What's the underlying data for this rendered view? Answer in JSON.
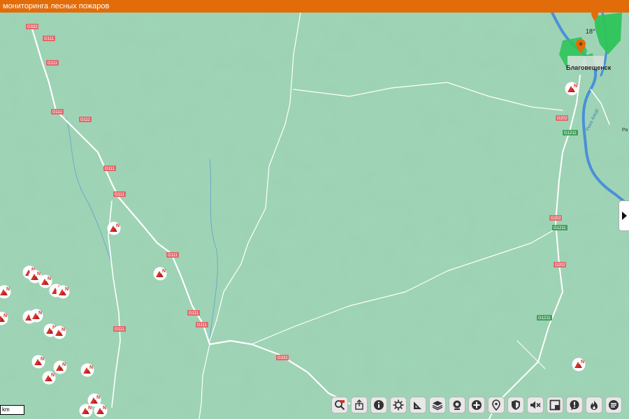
{
  "header": {
    "title": "мониторинга лесных пожаров"
  },
  "map": {
    "city": "Благовещенск",
    "river_label": "Река Амур",
    "right_edge_label": "Ра",
    "temperature_label": "18°",
    "road_labels": {
      "g332": "G332",
      "g111": "G111",
      "g202": "G202",
      "g1211": "G1211"
    }
  },
  "scale": {
    "label": "km"
  },
  "colors": {
    "land": "#9fd6b6",
    "road": "#ffffff",
    "highway_shield": "#e0686a",
    "river": "#4a90d9",
    "topbar": "#e36c0a",
    "forest_overlay": "#2ec45a",
    "fire_marker": "#d6312b"
  },
  "toolbar": {
    "icons": [
      "zoom-search-icon",
      "share-icon",
      "info-icon",
      "settings-gear-icon",
      "ruler-icon",
      "layers-icon",
      "webcam-icon",
      "zoom-in-icon",
      "location-pin-icon",
      "shield-icon",
      "mute-icon",
      "window-icon",
      "alert-icon",
      "fire-icon",
      "chat-icon"
    ]
  }
}
